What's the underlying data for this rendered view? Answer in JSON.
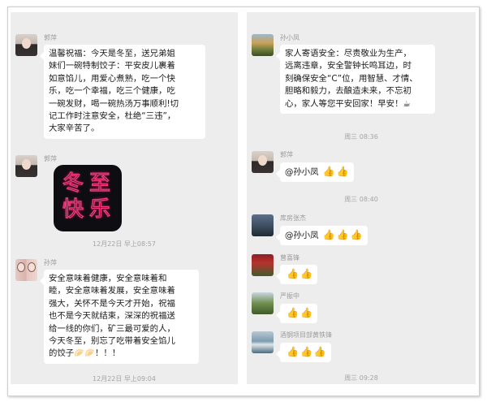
{
  "left": {
    "messages": [
      {
        "sender": "郭萍",
        "lines": [
          "温馨祝福：今天是冬至，送兄弟姐",
          "妹们一碗特制饺子：平安皮儿裹着",
          "如意馅儿，用爱心煮熟，吃一个快",
          "乐，吃一个幸福，吃三个健康，吃",
          "一碗发财，喝一碗热汤万事顺利!切",
          "记工作时注意安全，杜绝“三违”，",
          "大家辛苦了。"
        ]
      },
      {
        "sender": "郭萍",
        "sticker": [
          "冬",
          "至",
          "快",
          "乐"
        ]
      },
      {
        "timestamp": "12月22日 早上08:57"
      },
      {
        "sender": "孙萍",
        "lines": [
          "安全意味着健康，安全意味着和",
          "睦，安全意味着发展，安全意味着",
          "强大，关怀不是今天才开始，祝福",
          "也不是今天就结束，深深的祝福送",
          "给一线的你们，矿三最可爱的人，",
          "今天冬至，别忘了吃带着安全馅儿",
          "的饺子🥟🥟！！！"
        ]
      },
      {
        "timestamp": "12月22日 早上09:04"
      }
    ]
  },
  "right": {
    "messages": [
      {
        "sender": "孙小凤",
        "lines": [
          "家人寄语安全：尽责敬业为生产，",
          "远离违章，安全警钟长鸣耳边，时",
          "刻确保安全“C”位，用智慧、才情、",
          "胆略和毅力，去酿造未来，不忘初",
          "心，家人等您平安回家！早安！☕"
        ]
      },
      {
        "timestamp": "周三 08:36"
      },
      {
        "sender": "郭萍",
        "text": "@孙小凤",
        "thumbs": 2
      },
      {
        "timestamp": "周三 08:40"
      },
      {
        "sender": "库房张杰",
        "text": "@孙小凤",
        "thumbs": 3
      },
      {
        "sender": "曾喜锋",
        "thumbs": 2
      },
      {
        "sender": "严振中",
        "thumbs": 2
      },
      {
        "sender": "酒钢项目部黄铁锋",
        "thumbs": 3
      },
      {
        "timestamp": "周三 09:28"
      }
    ]
  },
  "thumb_glyph": "👍",
  "colors": {
    "background": "#ededed",
    "bubble": "#ffffff",
    "meta_text": "#9a9a9a",
    "sticker_glow": "#f03a7a"
  }
}
